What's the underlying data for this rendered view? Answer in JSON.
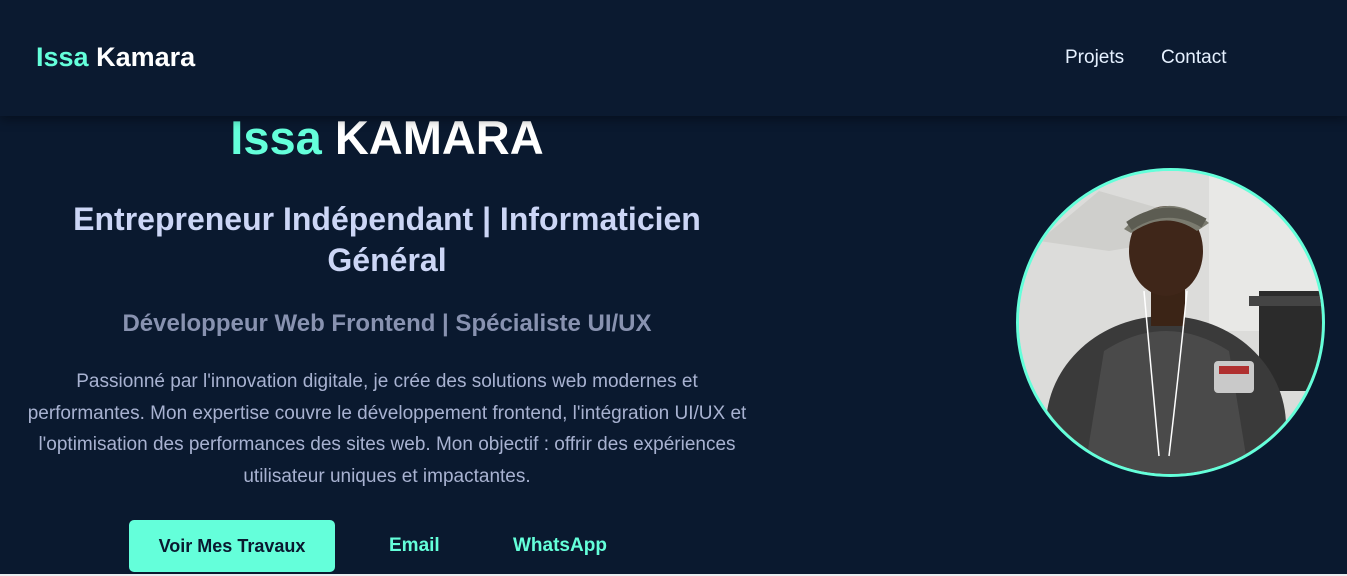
{
  "navbar": {
    "logo_first": "Issa",
    "logo_last": "Kamara",
    "links": [
      {
        "label": "Projets"
      },
      {
        "label": "Contact"
      }
    ]
  },
  "hero": {
    "name_first": "Issa",
    "name_last": "KAMARA",
    "title": "Entrepreneur Indépendant | Informaticien Général",
    "subtitle": "Développeur Web Frontend | Spécialiste UI/UX",
    "description": "Passionné par l'innovation digitale, je crée des solutions web modernes et performantes. Mon expertise couvre le développement frontend, l'intégration UI/UX et l'optimisation des performances des sites web. Mon objectif : offrir des expériences utilisateur uniques et impactantes.",
    "buttons": {
      "primary": "Voir Mes Travaux",
      "email": "Email",
      "whatsapp": "WhatsApp"
    }
  },
  "colors": {
    "background": "#0a192f",
    "accent": "#64ffda",
    "heading": "#ccd6f6",
    "muted": "#8892b0"
  },
  "profile_photo": "portrait-photo"
}
